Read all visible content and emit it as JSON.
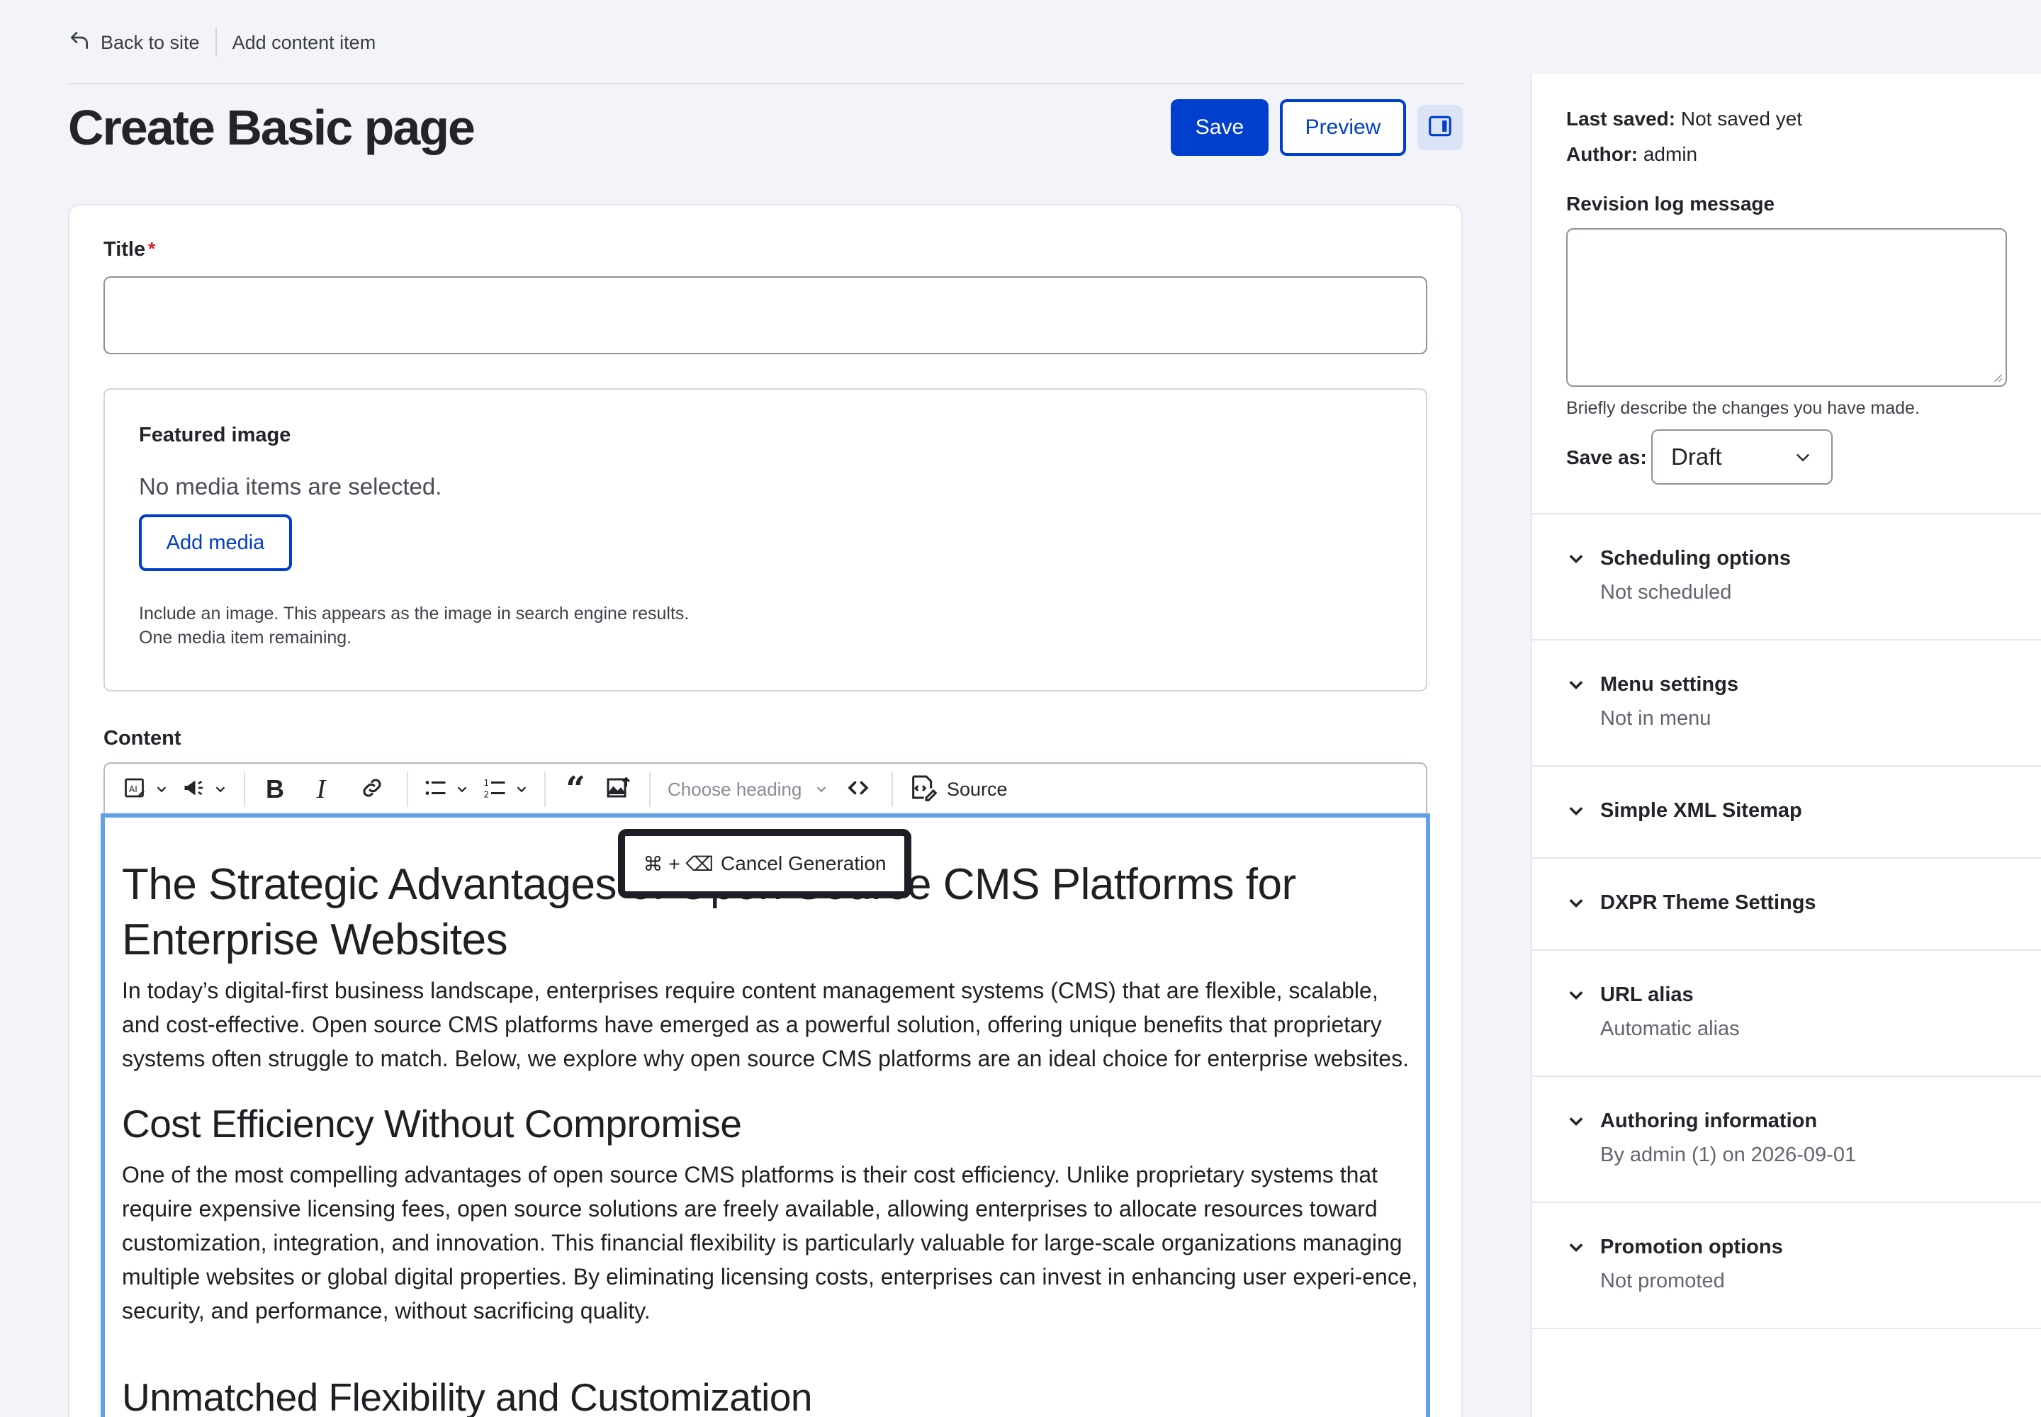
{
  "topbar": {
    "back_label": "Back to site",
    "breadcrumb": "Add content item"
  },
  "header": {
    "title": "Create Basic page",
    "save_label": "Save",
    "preview_label": "Preview"
  },
  "form": {
    "title_label": "Title",
    "required_mark": "*",
    "featured_image": {
      "legend": "Featured image",
      "empty_text": "No media items are selected.",
      "add_button": "Add media",
      "description_1": "Include an image. This appears as the image in search engine results.",
      "description_2": "One media item remaining."
    },
    "content_label": "Content"
  },
  "toolbar": {
    "heading_placeholder": "Choose heading",
    "source_label": "Source",
    "icons": [
      "ai-assistant-icon",
      "announcement-icon",
      "bold-icon",
      "italic-icon",
      "link-icon",
      "bulleted-list-icon",
      "numbered-list-icon",
      "blockquote-icon",
      "insert-image-icon",
      "code-icon",
      "source-icon"
    ]
  },
  "overlay": {
    "shortcut": "⌘ + ⌫",
    "label": "Cancel Generation"
  },
  "editor": {
    "h1": "The Strategic Advantages of Open Source CMS Platforms for Enterprise Websites",
    "p1": "In today’s digital-first business landscape, enterprises require content management systems (CMS) that are flexible, scalable, and cost-effective. Open source CMS platforms have emerged as a powerful solution, offering unique benefits that proprietary systems often struggle to match. Below, we explore why open source CMS platforms are an ideal choice for enterprise websites.",
    "h2_1": "Cost Efficiency Without Compromise",
    "p2": "One of the most compelling advantages of open source CMS platforms is their cost efficiency. Unlike proprietary systems that require expensive licensing fees, open source solutions are freely available, allowing enterprises to allocate resources toward customization, integration, and innovation. This financial flexibility is particularly valuable for large-scale organizations managing multiple websites or global digital properties. By eliminating licensing costs, enterprises can invest in enhancing user experi-ence, security, and performance, without sacrificing quality.",
    "h2_2": "Unmatched Flexibility and Customization"
  },
  "sidebar": {
    "last_saved_label": "Last saved:",
    "last_saved_value": "Not saved yet",
    "author_label": "Author:",
    "author_value": "admin",
    "revision_label": "Revision log message",
    "revision_help": "Briefly describe the changes you have made.",
    "save_as_label": "Save as:",
    "save_as_value": "Draft",
    "accordions": [
      {
        "title": "Scheduling options",
        "summary": "Not scheduled"
      },
      {
        "title": "Menu settings",
        "summary": "Not in menu"
      },
      {
        "title": "Simple XML Sitemap",
        "summary": ""
      },
      {
        "title": "DXPR Theme Settings",
        "summary": ""
      },
      {
        "title": "URL alias",
        "summary": "Automatic alias"
      },
      {
        "title": "Authoring information",
        "summary": "By admin (1) on 2026-09-01"
      },
      {
        "title": "Promotion options",
        "summary": "Not promoted"
      }
    ]
  }
}
